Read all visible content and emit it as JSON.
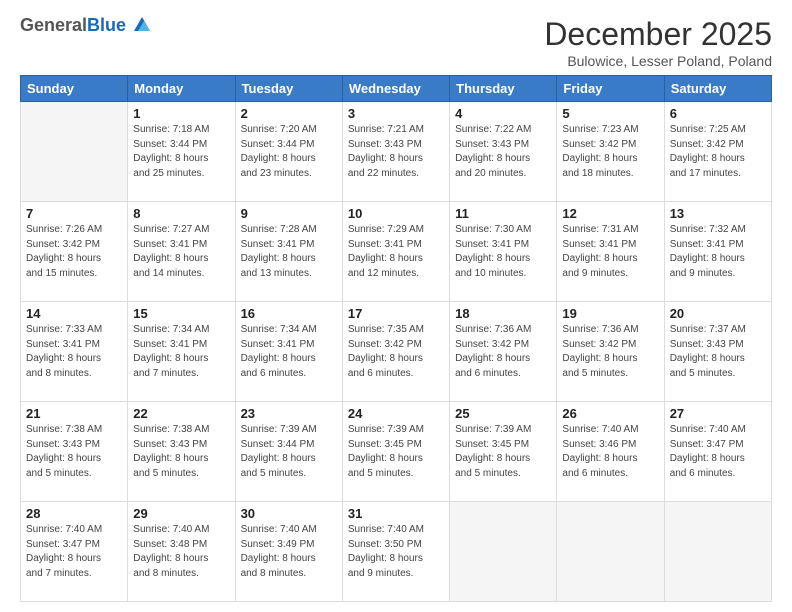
{
  "header": {
    "logo_general": "General",
    "logo_blue": "Blue",
    "month_title": "December 2025",
    "location": "Bulowice, Lesser Poland, Poland"
  },
  "weekdays": [
    "Sunday",
    "Monday",
    "Tuesday",
    "Wednesday",
    "Thursday",
    "Friday",
    "Saturday"
  ],
  "weeks": [
    [
      {
        "day": "",
        "info": ""
      },
      {
        "day": "1",
        "info": "Sunrise: 7:18 AM\nSunset: 3:44 PM\nDaylight: 8 hours\nand 25 minutes."
      },
      {
        "day": "2",
        "info": "Sunrise: 7:20 AM\nSunset: 3:44 PM\nDaylight: 8 hours\nand 23 minutes."
      },
      {
        "day": "3",
        "info": "Sunrise: 7:21 AM\nSunset: 3:43 PM\nDaylight: 8 hours\nand 22 minutes."
      },
      {
        "day": "4",
        "info": "Sunrise: 7:22 AM\nSunset: 3:43 PM\nDaylight: 8 hours\nand 20 minutes."
      },
      {
        "day": "5",
        "info": "Sunrise: 7:23 AM\nSunset: 3:42 PM\nDaylight: 8 hours\nand 18 minutes."
      },
      {
        "day": "6",
        "info": "Sunrise: 7:25 AM\nSunset: 3:42 PM\nDaylight: 8 hours\nand 17 minutes."
      }
    ],
    [
      {
        "day": "7",
        "info": "Sunrise: 7:26 AM\nSunset: 3:42 PM\nDaylight: 8 hours\nand 15 minutes."
      },
      {
        "day": "8",
        "info": "Sunrise: 7:27 AM\nSunset: 3:41 PM\nDaylight: 8 hours\nand 14 minutes."
      },
      {
        "day": "9",
        "info": "Sunrise: 7:28 AM\nSunset: 3:41 PM\nDaylight: 8 hours\nand 13 minutes."
      },
      {
        "day": "10",
        "info": "Sunrise: 7:29 AM\nSunset: 3:41 PM\nDaylight: 8 hours\nand 12 minutes."
      },
      {
        "day": "11",
        "info": "Sunrise: 7:30 AM\nSunset: 3:41 PM\nDaylight: 8 hours\nand 10 minutes."
      },
      {
        "day": "12",
        "info": "Sunrise: 7:31 AM\nSunset: 3:41 PM\nDaylight: 8 hours\nand 9 minutes."
      },
      {
        "day": "13",
        "info": "Sunrise: 7:32 AM\nSunset: 3:41 PM\nDaylight: 8 hours\nand 9 minutes."
      }
    ],
    [
      {
        "day": "14",
        "info": "Sunrise: 7:33 AM\nSunset: 3:41 PM\nDaylight: 8 hours\nand 8 minutes."
      },
      {
        "day": "15",
        "info": "Sunrise: 7:34 AM\nSunset: 3:41 PM\nDaylight: 8 hours\nand 7 minutes."
      },
      {
        "day": "16",
        "info": "Sunrise: 7:34 AM\nSunset: 3:41 PM\nDaylight: 8 hours\nand 6 minutes."
      },
      {
        "day": "17",
        "info": "Sunrise: 7:35 AM\nSunset: 3:42 PM\nDaylight: 8 hours\nand 6 minutes."
      },
      {
        "day": "18",
        "info": "Sunrise: 7:36 AM\nSunset: 3:42 PM\nDaylight: 8 hours\nand 6 minutes."
      },
      {
        "day": "19",
        "info": "Sunrise: 7:36 AM\nSunset: 3:42 PM\nDaylight: 8 hours\nand 5 minutes."
      },
      {
        "day": "20",
        "info": "Sunrise: 7:37 AM\nSunset: 3:43 PM\nDaylight: 8 hours\nand 5 minutes."
      }
    ],
    [
      {
        "day": "21",
        "info": "Sunrise: 7:38 AM\nSunset: 3:43 PM\nDaylight: 8 hours\nand 5 minutes."
      },
      {
        "day": "22",
        "info": "Sunrise: 7:38 AM\nSunset: 3:43 PM\nDaylight: 8 hours\nand 5 minutes."
      },
      {
        "day": "23",
        "info": "Sunrise: 7:39 AM\nSunset: 3:44 PM\nDaylight: 8 hours\nand 5 minutes."
      },
      {
        "day": "24",
        "info": "Sunrise: 7:39 AM\nSunset: 3:45 PM\nDaylight: 8 hours\nand 5 minutes."
      },
      {
        "day": "25",
        "info": "Sunrise: 7:39 AM\nSunset: 3:45 PM\nDaylight: 8 hours\nand 5 minutes."
      },
      {
        "day": "26",
        "info": "Sunrise: 7:40 AM\nSunset: 3:46 PM\nDaylight: 8 hours\nand 6 minutes."
      },
      {
        "day": "27",
        "info": "Sunrise: 7:40 AM\nSunset: 3:47 PM\nDaylight: 8 hours\nand 6 minutes."
      }
    ],
    [
      {
        "day": "28",
        "info": "Sunrise: 7:40 AM\nSunset: 3:47 PM\nDaylight: 8 hours\nand 7 minutes."
      },
      {
        "day": "29",
        "info": "Sunrise: 7:40 AM\nSunset: 3:48 PM\nDaylight: 8 hours\nand 8 minutes."
      },
      {
        "day": "30",
        "info": "Sunrise: 7:40 AM\nSunset: 3:49 PM\nDaylight: 8 hours\nand 8 minutes."
      },
      {
        "day": "31",
        "info": "Sunrise: 7:40 AM\nSunset: 3:50 PM\nDaylight: 8 hours\nand 9 minutes."
      },
      {
        "day": "",
        "info": ""
      },
      {
        "day": "",
        "info": ""
      },
      {
        "day": "",
        "info": ""
      }
    ]
  ]
}
